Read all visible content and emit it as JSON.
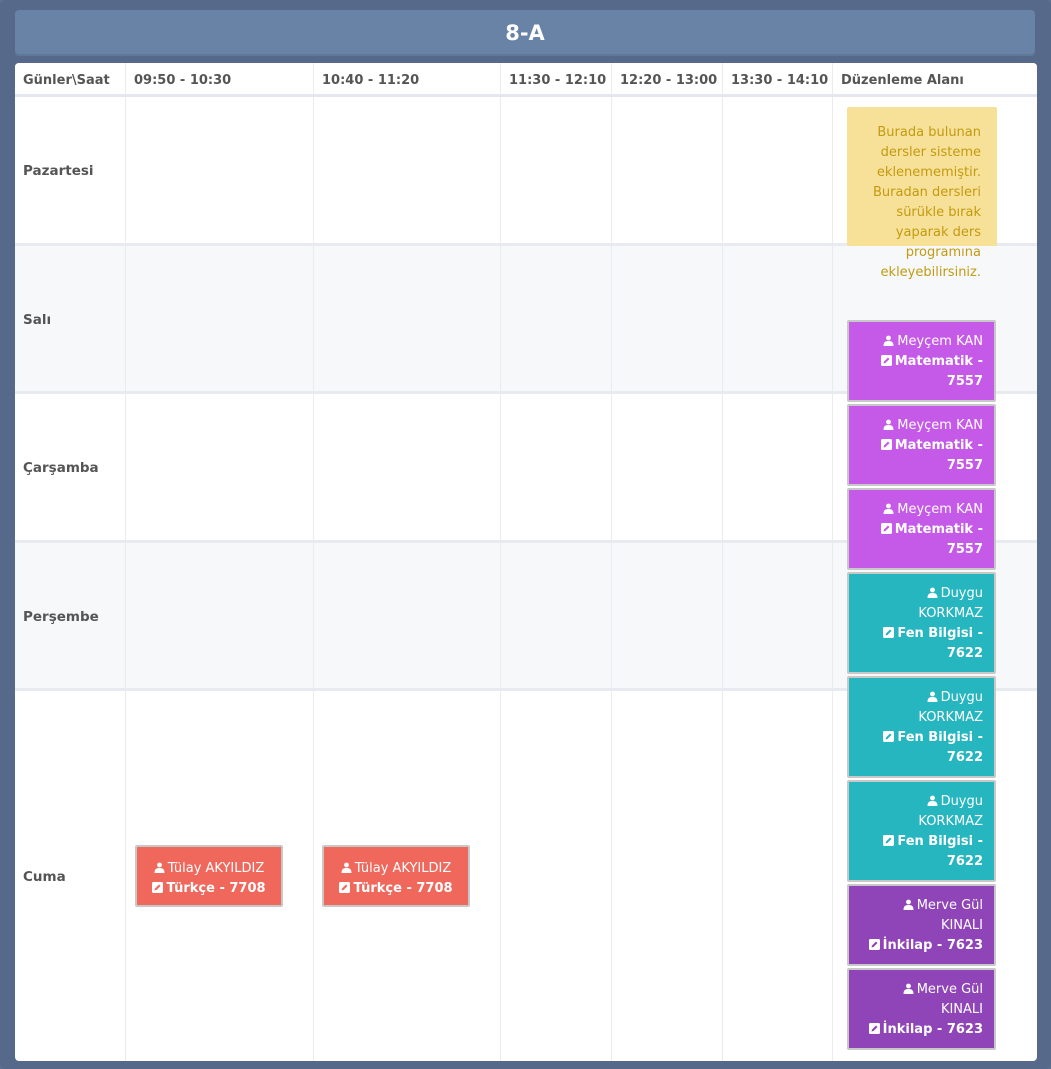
{
  "title": "8-A",
  "header": {
    "corner": "Günler\\Saat",
    "periods": [
      "09:50 - 10:30",
      "10:40 - 11:20",
      "11:30 - 12:10",
      "12:20 - 13:00",
      "13:30 - 14:10"
    ],
    "edit_area": "Düzenleme Alanı"
  },
  "days": [
    "Pazartesi",
    "Salı",
    "Çarşamba",
    "Perşembe",
    "Cuma"
  ],
  "note": {
    "text": "Burada bulunan dersler sisteme eklenememiştir. Buradan dersleri sürükle bırak yaparak ders programına ekleyebilirsiniz."
  },
  "icons": {
    "teacher": "user-group-icon",
    "lesson": "edit-icon"
  },
  "colors": {
    "matematik": "#c55ae8",
    "fen": "#26b6c0",
    "inkilap": "#8f44b7",
    "turkce": "#f0685c",
    "note_bg": "#f7e199",
    "note_text": "#c39a10"
  },
  "pending_lessons": [
    {
      "teacher_1": "Meyçem KAN",
      "teacher_2": "",
      "lesson_1": "Matematik -",
      "lesson_2": "7557"
    },
    {
      "teacher_1": "Meyçem KAN",
      "teacher_2": "",
      "lesson_1": "Matematik -",
      "lesson_2": "7557"
    },
    {
      "teacher_1": "Meyçem KAN",
      "teacher_2": "",
      "lesson_1": "Matematik -",
      "lesson_2": "7557"
    },
    {
      "teacher_1": "Duygu",
      "teacher_2": "KORKMAZ",
      "lesson_1": "Fen Bilgisi -",
      "lesson_2": "7622"
    },
    {
      "teacher_1": "Duygu",
      "teacher_2": "KORKMAZ",
      "lesson_1": "Fen Bilgisi -",
      "lesson_2": "7622"
    },
    {
      "teacher_1": "Duygu",
      "teacher_2": "KORKMAZ",
      "lesson_1": "Fen Bilgisi -",
      "lesson_2": "7622"
    },
    {
      "teacher_1": "Merve Gül",
      "teacher_2": "KINALI",
      "lesson_1": "İnkilap - 7623",
      "lesson_2": ""
    },
    {
      "teacher_1": "Merve Gül",
      "teacher_2": "KINALI",
      "lesson_1": "İnkilap - 7623",
      "lesson_2": ""
    }
  ],
  "scheduled": [
    {
      "day": "Cuma",
      "period": "09:50 - 10:30",
      "teacher": "Tülay AKYILDIZ",
      "lesson": "Türkçe - 7708"
    },
    {
      "day": "Cuma",
      "period": "10:40 - 11:20",
      "teacher": "Tülay AKYILDIZ",
      "lesson": "Türkçe - 7708"
    }
  ]
}
